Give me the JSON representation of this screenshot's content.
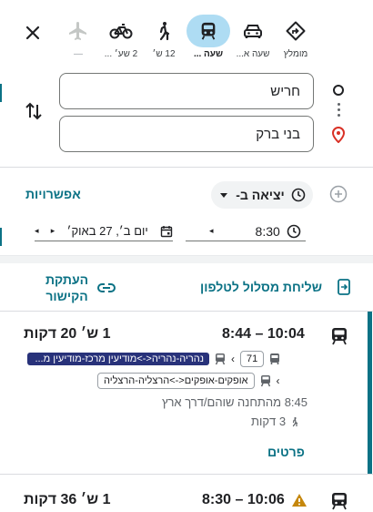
{
  "modes": [
    {
      "id": "best",
      "label": "מומלץ",
      "selected": false
    },
    {
      "id": "drive",
      "label": "שעה א...",
      "selected": false
    },
    {
      "id": "transit",
      "label": "שעה ...",
      "selected": true
    },
    {
      "id": "walk",
      "label": "12 ש׳",
      "selected": false
    },
    {
      "id": "bike",
      "label": "2 שע׳ ...",
      "selected": false
    },
    {
      "id": "flight",
      "label": "—",
      "selected": false
    }
  ],
  "origin": "חריש",
  "destination": "בני ברק",
  "options": {
    "label": "אפשרויות",
    "depart": "יציאה ב-",
    "time": "8:30",
    "date": "יום ב׳, 27 באוק׳"
  },
  "share": {
    "send": "שליחת מסלול לטלפון",
    "copy_line1": "העתקת",
    "copy_line2": "הקישור"
  },
  "route1": {
    "times": "8:44 – 10:04",
    "duration": "1 ש׳ 20 דקות",
    "line_num": "71",
    "train1": "נהריה-נהריה<->מודיעין מרכז-מודיעין מ...",
    "train2": "אופקים-אופקים<->הרצליה-הרצליה",
    "depart_info": "8:45 מהתחנה שוהם/דרך ארץ",
    "walk": "3 דקות",
    "details": "פרטים"
  },
  "route2": {
    "times": "8:30 – 10:06",
    "duration": "1 ש׳ 36 דקות"
  },
  "colors": {
    "accent": "#0b7285",
    "selected_mode": "#aedcf3",
    "train1_bg": "#28327a",
    "alert": "#c5870c",
    "pin": "#d93025"
  }
}
